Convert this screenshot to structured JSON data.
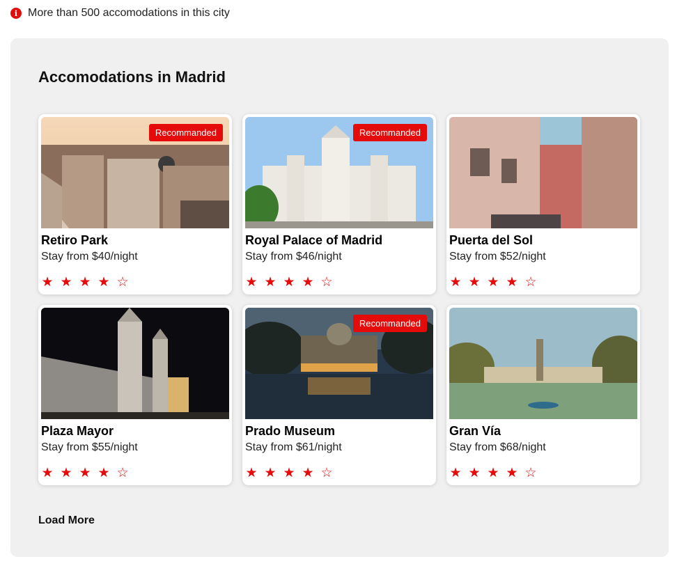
{
  "notice": {
    "icon": "info-icon",
    "text": "More than 500 accomodations in this city"
  },
  "section": {
    "title": "Accomodations in Madrid"
  },
  "badge_label": "Recommanded",
  "accent_color": "#e50b0b",
  "cards": [
    {
      "title": "Retiro Park",
      "price": "Stay from $40/night",
      "recommended": true,
      "rating": 4,
      "max_rating": 5
    },
    {
      "title": "Royal Palace of Madrid",
      "price": "Stay from $46/night",
      "recommended": true,
      "rating": 4,
      "max_rating": 5
    },
    {
      "title": "Puerta del Sol",
      "price": "Stay from $52/night",
      "recommended": false,
      "rating": 4,
      "max_rating": 5
    },
    {
      "title": "Plaza Mayor",
      "price": "Stay from $55/night",
      "recommended": false,
      "rating": 4,
      "max_rating": 5
    },
    {
      "title": "Prado Museum",
      "price": "Stay from $61/night",
      "recommended": true,
      "rating": 4,
      "max_rating": 5
    },
    {
      "title": "Gran Vía",
      "price": "Stay from $68/night",
      "recommended": false,
      "rating": 4,
      "max_rating": 5
    }
  ],
  "load_more": "Load More"
}
